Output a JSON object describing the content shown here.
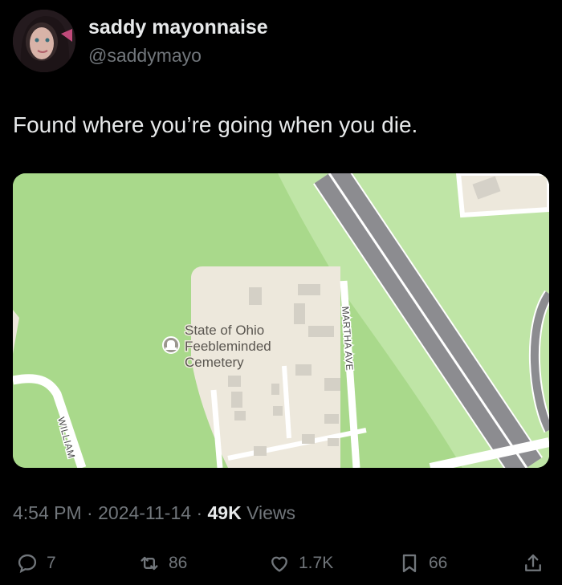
{
  "author": {
    "display_name": "saddy mayonnaise",
    "handle": "@saddymayo"
  },
  "tweet": {
    "text": "Found where you’re going when you die."
  },
  "map": {
    "place_label_line1": "State of Ohio",
    "place_label_line2": "Feebleminded",
    "place_label_line3": "Cemetery",
    "street_martha": "MARTHA AVE",
    "street_william": "WILLIAM"
  },
  "meta": {
    "time": "4:54 PM",
    "separator": "·",
    "date": "2024-11-14",
    "views_count": "49K",
    "views_label": "Views"
  },
  "actions": {
    "replies": "7",
    "reposts": "86",
    "likes": "1.7K",
    "bookmarks": "66"
  },
  "icons": [
    "avatar",
    "reply-icon",
    "repost-icon",
    "like-icon",
    "bookmark-icon",
    "share-icon",
    "cemetery-icon"
  ],
  "colors": {
    "background": "#000000",
    "text_primary": "#e7e9ea",
    "text_secondary": "#71767b",
    "map_grass": "#a8d98c",
    "map_road": "#8e8e93"
  }
}
